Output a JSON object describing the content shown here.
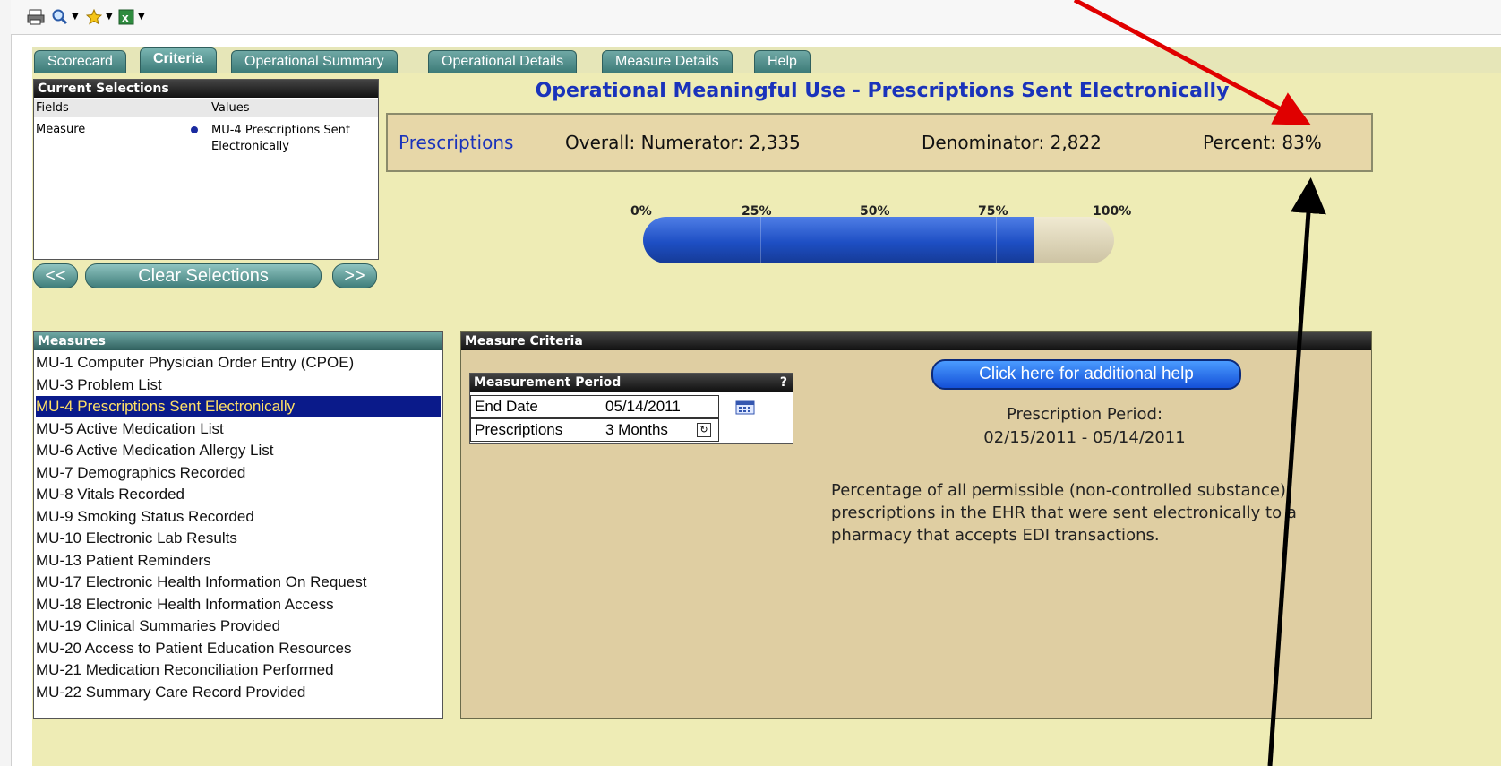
{
  "toolbar": {
    "icons": [
      "print-icon",
      "search-icon",
      "favorites-star-icon",
      "excel-icon"
    ]
  },
  "tabs": [
    {
      "label": "Scorecard"
    },
    {
      "label": "Criteria"
    },
    {
      "label": "Operational Summary"
    },
    {
      "label": "Operational Details"
    },
    {
      "label": "Measure Details"
    },
    {
      "label": "Help"
    }
  ],
  "current_selections": {
    "title": "Current Selections",
    "col_fields": "Fields",
    "col_values": "Values",
    "field": "Measure",
    "value_line1": "MU-4  Prescriptions Sent",
    "value_line2": "Electronically"
  },
  "nav": {
    "prev": "<<",
    "clear": "Clear Selections",
    "next": ">>"
  },
  "main": {
    "title": "Operational Meaningful Use - Prescriptions Sent Electronically",
    "summary": {
      "label": "Prescriptions",
      "numerator": "Overall: Numerator: 2,335",
      "denominator": "Denominator: 2,822",
      "percent": "Percent: 83%"
    },
    "gauge": {
      "ticks": [
        "0%",
        "25%",
        "50%",
        "75%",
        "100%"
      ],
      "value": 0.83
    }
  },
  "measures": {
    "title": "Measures",
    "items": [
      "MU-1  Computer Physician Order Entry (CPOE)",
      "MU-3  Problem List",
      "MU-4  Prescriptions Sent Electronically",
      "MU-5  Active Medication List",
      "MU-6  Active Medication Allergy List",
      "MU-7  Demographics Recorded",
      "MU-8  Vitals Recorded",
      "MU-9  Smoking Status Recorded",
      "MU-10  Electronic Lab Results",
      "MU-13  Patient Reminders",
      "MU-17  Electronic Health Information On Request",
      "MU-18  Electronic Health Information Access",
      "MU-19  Clinical Summaries Provided",
      "MU-20  Access to Patient Education Resources",
      "MU-21  Medication Reconciliation Performed",
      "MU-22  Summary Care Record Provided"
    ],
    "selected_index": 2
  },
  "criteria": {
    "title": "Measure Criteria",
    "period_box": {
      "title": "Measurement Period",
      "help": "?",
      "end_date_label": "End Date",
      "end_date_value": "05/14/2011",
      "prescriptions_label": "Prescriptions",
      "prescriptions_value": "3 Months"
    },
    "help_button": "Click here for additional help",
    "period_label": "Prescription Period:",
    "period_range": "02/15/2011 - 05/14/2011",
    "description": "Percentage of all permissible (non-controlled substance) prescriptions in the EHR that were sent electronically to a pharmacy that accepts EDI transactions."
  },
  "colors": {
    "accent_teal": "#3d7b78",
    "background": "#eeecb5",
    "title_blue": "#1a33bb",
    "gauge_blue": "#1e4fc4",
    "selected_row": "#0a1a8a",
    "annotation_red": "#e00000",
    "annotation_black": "#000000"
  }
}
